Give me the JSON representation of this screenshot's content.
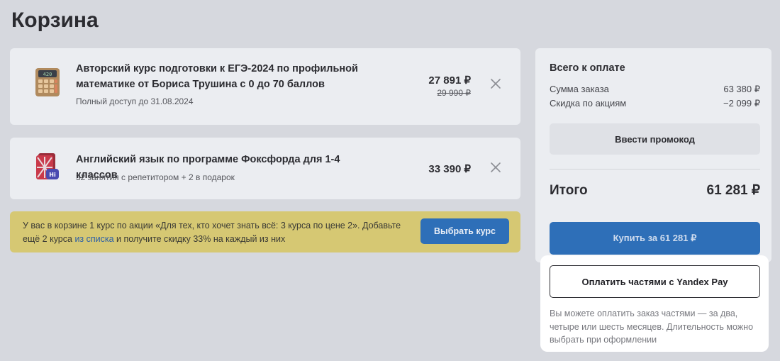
{
  "page": {
    "title": "Корзина"
  },
  "cart": {
    "items": [
      {
        "title": "Авторский курс подготовки к ЕГЭ-2024 по профильной математике от Бориса Трушина с 0 до 70 баллов",
        "subtitle": "Полный доступ до 31.08.2024",
        "price": "27 891 ₽",
        "old_price": "29 990 ₽",
        "icon": "calculator-icon"
      },
      {
        "title": "Английский язык по программе Фоксфорда для 1-4 классов",
        "subtitle": "32 занятия с репетитором + 2 в подарок",
        "price": "33 390 ₽",
        "icon": "english-book-icon"
      }
    ]
  },
  "promo": {
    "text_part1": "У вас в корзине 1 курс по акции «Для тех, кто хочет знать всё: 3 курса по цене 2». Добавьте ещё 2 курса ",
    "link": "из списка",
    "text_part2": " и получите скидку 33% на каждый из них",
    "button": "Выбрать курс"
  },
  "summary": {
    "title": "Всего к оплате",
    "order_sum_label": "Сумма заказа",
    "order_sum_value": "63 380 ₽",
    "discount_label": "Скидка по акциям",
    "discount_value": "−2 099 ₽",
    "promo_code_button": "Ввести промокод",
    "total_label": "Итого",
    "total_value": "61 281 ₽",
    "buy_button": "Купить за  61 281 ₽"
  },
  "yandex": {
    "button": "Оплатить частями с Yandex Pay",
    "note": "Вы можете оплатить заказ частями — за два, четыре или шесть месяцев. Длительность можно выбрать при оформлении"
  },
  "colors": {
    "background": "#d6d8de",
    "card": "#ebedf1",
    "accent_blue": "#2e6fb8",
    "promo_yellow": "#d6c873",
    "link": "#2a5ea8"
  }
}
